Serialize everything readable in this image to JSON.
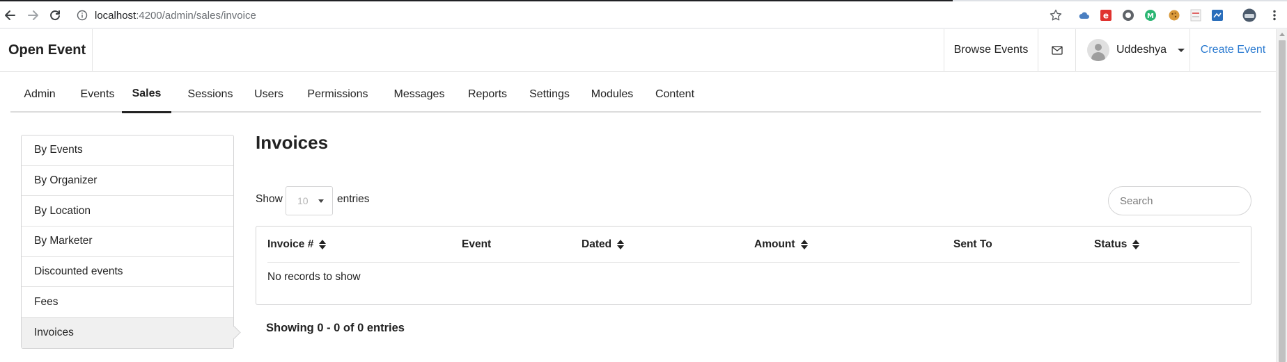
{
  "browser": {
    "url_host": "localhost",
    "url_path": ":4200/admin/sales/invoice"
  },
  "header": {
    "brand": "Open Event",
    "browse_events": "Browse Events",
    "user_name": "Uddeshya",
    "create_event": "Create Event"
  },
  "tabs": [
    {
      "label": "Admin"
    },
    {
      "label": "Events"
    },
    {
      "label": "Sales",
      "active": true
    },
    {
      "label": "Sessions"
    },
    {
      "label": "Users"
    },
    {
      "label": "Permissions"
    },
    {
      "label": "Messages"
    },
    {
      "label": "Reports"
    },
    {
      "label": "Settings"
    },
    {
      "label": "Modules"
    },
    {
      "label": "Content"
    }
  ],
  "sidebar": {
    "items": [
      {
        "label": "By Events"
      },
      {
        "label": "By Organizer"
      },
      {
        "label": "By Location"
      },
      {
        "label": "By Marketer"
      },
      {
        "label": "Discounted events"
      },
      {
        "label": "Fees"
      },
      {
        "label": "Invoices",
        "active": true
      }
    ]
  },
  "main": {
    "title": "Invoices",
    "show_label": "Show",
    "entries_value": "10",
    "entries_label": "entries",
    "search_placeholder": "Search",
    "columns": [
      {
        "label": "Invoice #",
        "sortable": true
      },
      {
        "label": "Event",
        "sortable": false
      },
      {
        "label": "Dated",
        "sortable": true
      },
      {
        "label": "Amount",
        "sortable": true
      },
      {
        "label": "Sent To",
        "sortable": false
      },
      {
        "label": "Status",
        "sortable": true
      }
    ],
    "empty_message": "No records to show",
    "showing_text": "Showing 0 - 0 of 0 entries"
  },
  "colors": {
    "accent_link": "#2a7ad0",
    "border": "#d4d4d5",
    "active_bg": "#f0f0f0"
  }
}
